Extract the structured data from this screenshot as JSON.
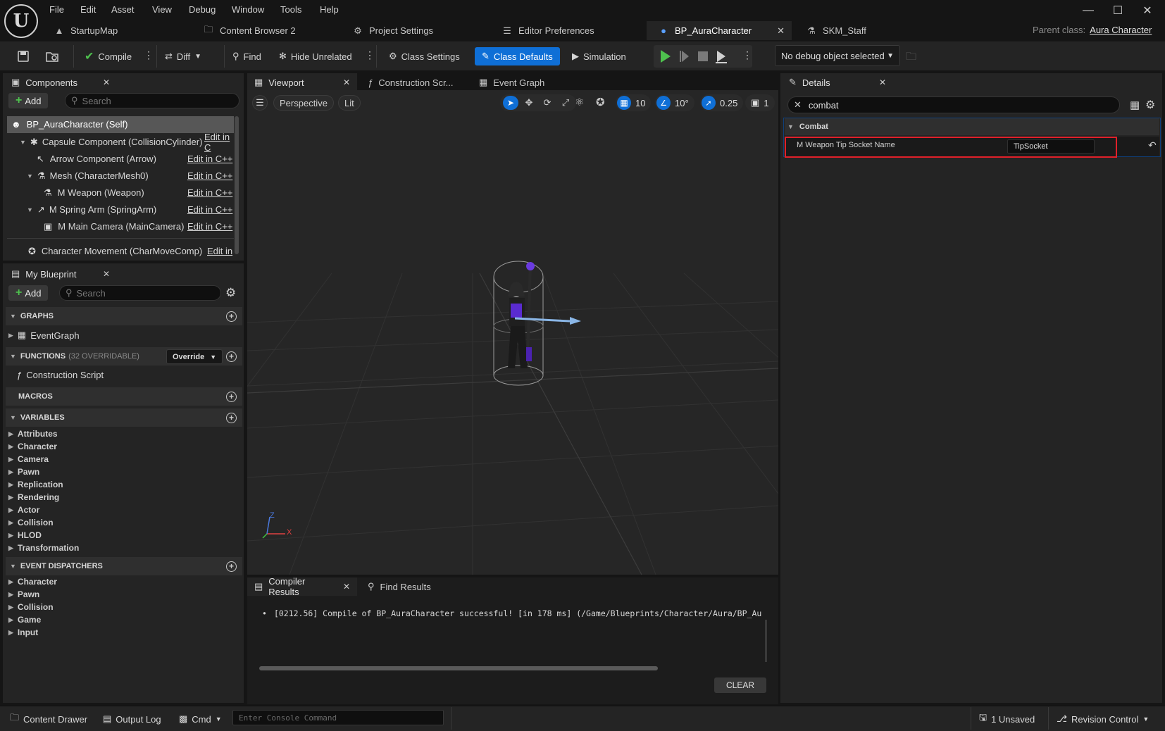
{
  "menu": [
    "File",
    "Edit",
    "Asset",
    "View",
    "Debug",
    "Window",
    "Tools",
    "Help"
  ],
  "tabs": [
    {
      "label": "StartupMap",
      "icon": "level-icon"
    },
    {
      "label": "Content Browser 2",
      "icon": "folder-icon"
    },
    {
      "label": "Project Settings",
      "icon": "settings-icon"
    },
    {
      "label": "Editor Preferences",
      "icon": "sliders-icon"
    },
    {
      "label": "BP_AuraCharacter",
      "icon": "character-icon",
      "active": true
    },
    {
      "label": "SKM_Staff",
      "icon": "skeletal-mesh-icon"
    }
  ],
  "parent_class": {
    "label": "Parent class:",
    "value": "Aura Character"
  },
  "toolbar": {
    "compile": "Compile",
    "diff": "Diff",
    "find": "Find",
    "hide_unrelated": "Hide Unrelated",
    "class_settings": "Class Settings",
    "class_defaults": "Class Defaults",
    "simulation": "Simulation",
    "debug_object": "No debug object selected"
  },
  "components": {
    "title": "Components",
    "add": "Add",
    "search_placeholder": "Search",
    "items": [
      {
        "label": "BP_AuraCharacter (Self)",
        "edit": ""
      },
      {
        "label": "Capsule Component (CollisionCylinder)",
        "edit": "Edit in C"
      },
      {
        "label": "Arrow Component (Arrow)",
        "edit": "Edit in C++"
      },
      {
        "label": "Mesh (CharacterMesh0)",
        "edit": "Edit in C++"
      },
      {
        "label": "M Weapon (Weapon)",
        "edit": "Edit in C++"
      },
      {
        "label": "M Spring Arm (SpringArm)",
        "edit": "Edit in C++"
      },
      {
        "label": "M Main Camera (MainCamera)",
        "edit": "Edit in C++"
      },
      {
        "label": "Character Movement (CharMoveComp)",
        "edit": "Edit in"
      }
    ]
  },
  "my_blueprint": {
    "title": "My Blueprint",
    "add": "Add",
    "search_placeholder": "Search",
    "graphs": "GRAPHS",
    "event_graph": "EventGraph",
    "functions": "FUNCTIONS",
    "functions_count": "(32 OVERRIDABLE)",
    "override": "Override",
    "construction_script": "Construction Script",
    "macros": "MACROS",
    "variables": "VARIABLES",
    "variable_categories": [
      "Attributes",
      "Character",
      "Camera",
      "Pawn",
      "Replication",
      "Rendering",
      "Actor",
      "Collision",
      "HLOD",
      "Transformation"
    ],
    "event_dispatchers": "EVENT DISPATCHERS",
    "dispatcher_categories": [
      "Character",
      "Pawn",
      "Collision",
      "Game",
      "Input"
    ]
  },
  "editor_tabs": {
    "viewport": "Viewport",
    "construction": "Construction Scr...",
    "event_graph": "Event Graph"
  },
  "viewport": {
    "perspective": "Perspective",
    "lit": "Lit",
    "grid_snap": "10",
    "rot_snap": "10°",
    "scale_snap": "0.25",
    "camera_speed": "1",
    "axis_x": "X",
    "axis_z": "Z"
  },
  "details": {
    "title": "Details",
    "search_value": "combat",
    "category": "Combat",
    "property_label": "M Weapon Tip Socket Name",
    "property_value": "TipSocket"
  },
  "compiler": {
    "tab": "Compiler Results",
    "find_tab": "Find Results",
    "message": "[0212.56] Compile of BP_AuraCharacter successful! [in 178 ms] (/Game/Blueprints/Character/Aura/BP_Au",
    "clear": "CLEAR"
  },
  "statusbar": {
    "content_drawer": "Content Drawer",
    "output_log": "Output Log",
    "cmd": "Cmd",
    "console_placeholder": "Enter Console Command",
    "unsaved": "1 Unsaved",
    "revision_control": "Revision Control"
  },
  "colors": {
    "accent": "#0f6fd6",
    "highlight_box": "#e0202a",
    "play_green": "#4ec24e"
  }
}
